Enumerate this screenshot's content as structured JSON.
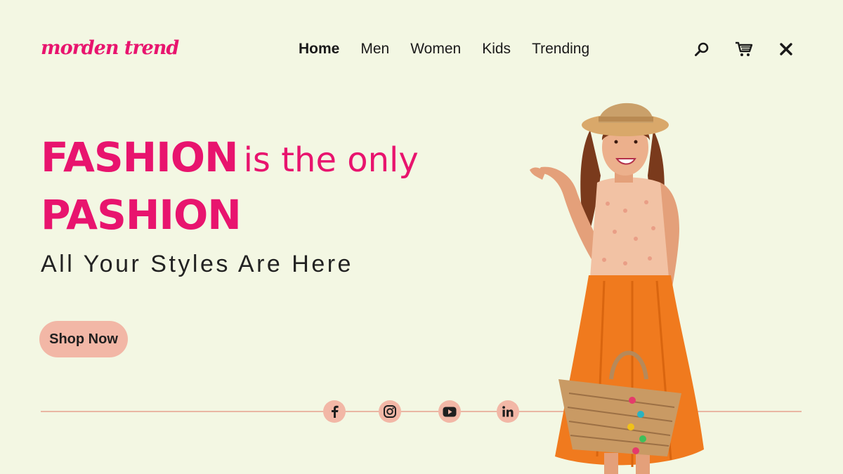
{
  "brand": {
    "logo_text": "morden trend",
    "accent_color": "#e8146e"
  },
  "nav": {
    "items": [
      {
        "label": "Home",
        "active": true
      },
      {
        "label": "Men",
        "active": false
      },
      {
        "label": "Women",
        "active": false
      },
      {
        "label": "Kids",
        "active": false
      },
      {
        "label": "Trending",
        "active": false
      }
    ]
  },
  "header_icons": [
    "search-icon",
    "cart-icon",
    "close-icon"
  ],
  "hero": {
    "headline_strong_1": "FASHION",
    "headline_light": "is the only",
    "headline_strong_2": "PASHION",
    "subtitle": "All Your Styles Are Here",
    "cta_label": "Shop Now",
    "cta_color": "#f2b7a6"
  },
  "social": [
    "facebook-icon",
    "instagram-icon",
    "youtube-icon",
    "linkedin-icon"
  ],
  "colors": {
    "background": "#f3f7e3",
    "line": "#e9b6a3"
  }
}
